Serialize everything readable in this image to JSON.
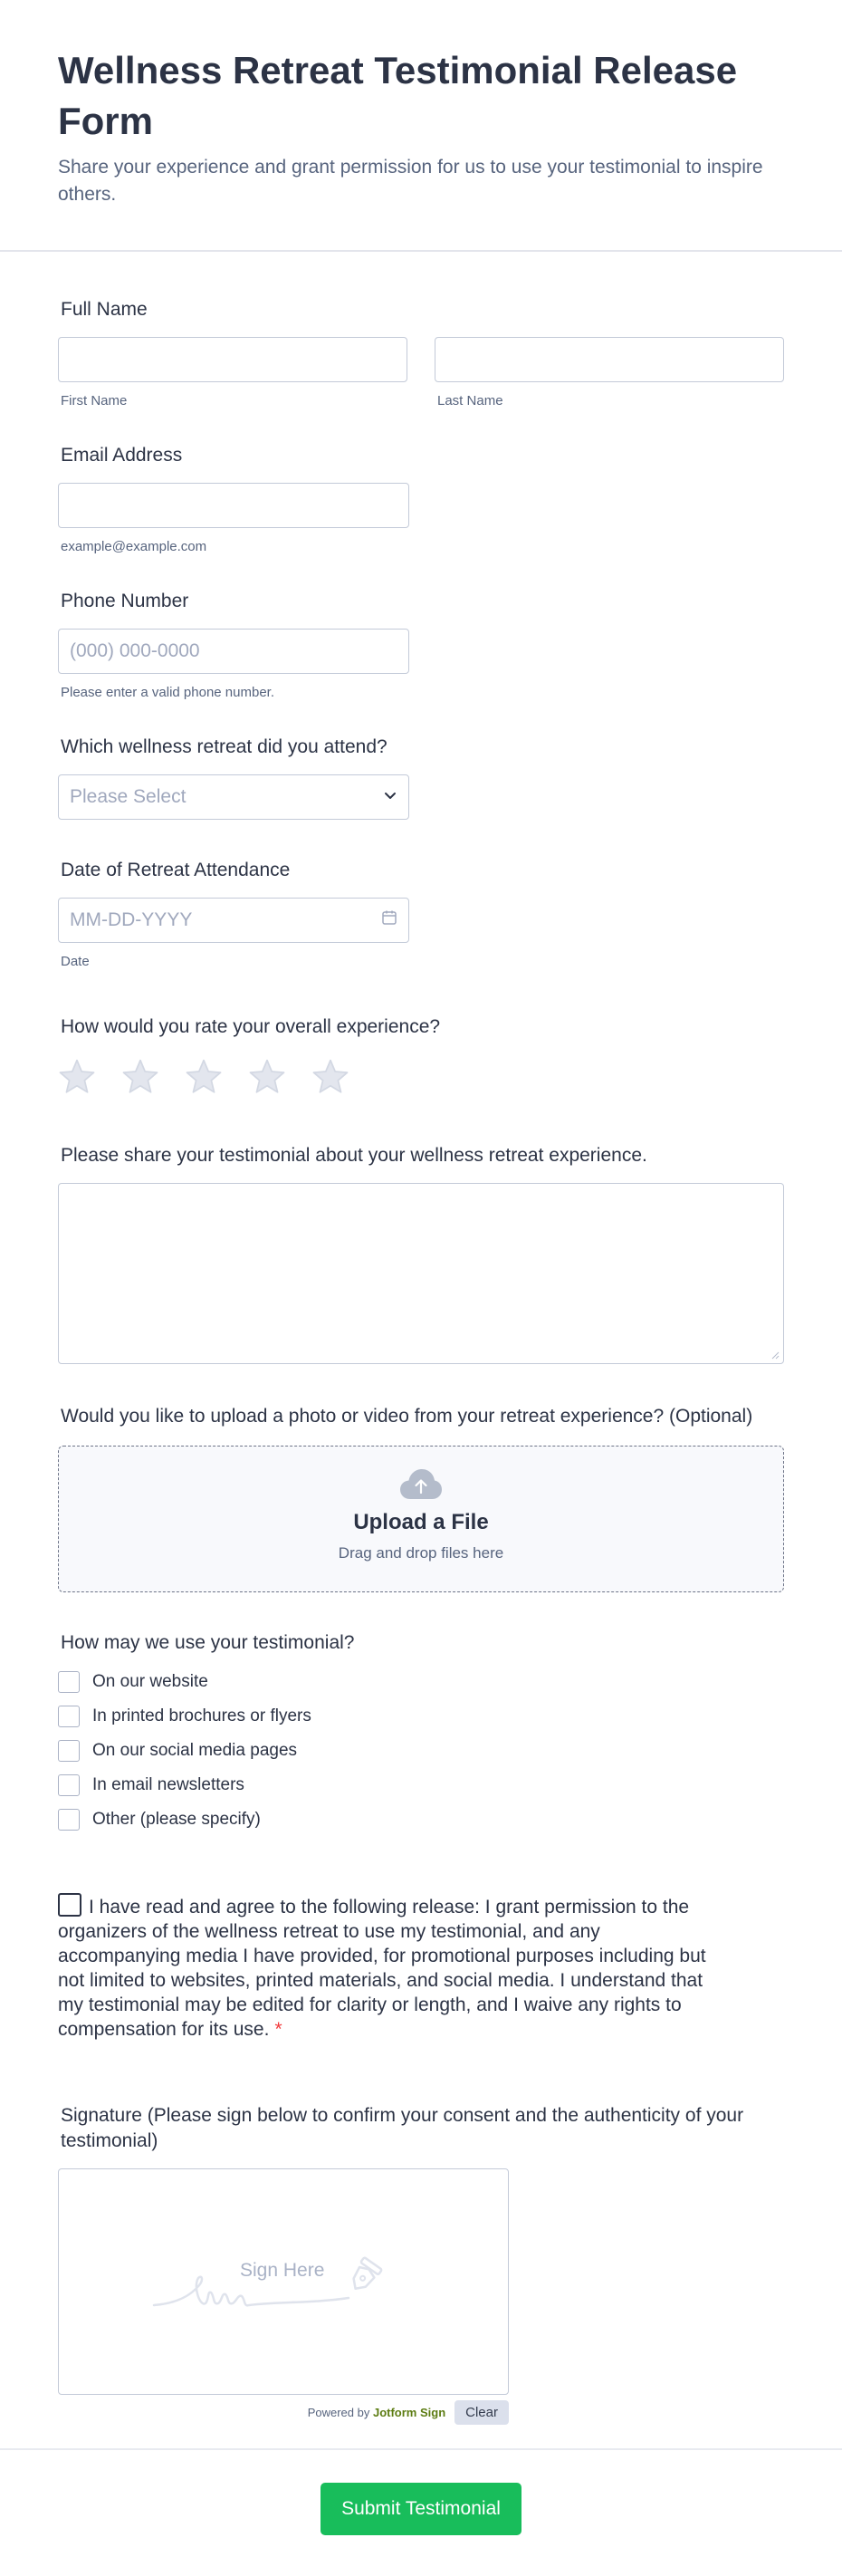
{
  "header": {
    "title": "Wellness Retreat Testimonial Release Form",
    "subtitle": "Share your experience and grant permission for us to use your testimonial to inspire others."
  },
  "full_name": {
    "label": "Full Name",
    "first_sublabel": "First Name",
    "last_sublabel": "Last Name",
    "first_value": "",
    "last_value": ""
  },
  "email": {
    "label": "Email Address",
    "value": "",
    "sublabel": "example@example.com"
  },
  "phone": {
    "label": "Phone Number",
    "placeholder": "(000) 000-0000",
    "sublabel": "Please enter a valid phone number."
  },
  "retreat": {
    "label": "Which wellness retreat did you attend?",
    "selected": "Please Select"
  },
  "date": {
    "label": "Date of Retreat Attendance",
    "placeholder": "MM-DD-YYYY",
    "sublabel": "Date"
  },
  "rating": {
    "label": "How would you rate your overall experience?",
    "max": 5,
    "value": 0
  },
  "testimonial": {
    "label": "Please share your testimonial about your wellness retreat experience.",
    "value": ""
  },
  "upload": {
    "label": "Would you like to upload a photo or video from your retreat experience? (Optional)",
    "title": "Upload a File",
    "subtitle": "Drag and drop files here"
  },
  "usage": {
    "label": "How may we use your testimonial?",
    "options": [
      "On our website",
      "In printed brochures or flyers",
      "On our social media pages",
      "In email newsletters",
      "Other (please specify)"
    ]
  },
  "consent": {
    "text": "I have read and agree to the following release: I grant permission to the organizers of the wellness retreat to use my testimonial, and any accompanying media I have provided, for promotional purposes including but not limited to websites, printed materials, and social media. I understand that my testimonial may be edited for clarity or length, and I waive any rights to compensation for its use.",
    "required_mark": "*"
  },
  "signature": {
    "label": "Signature (Please sign below to confirm your consent and the authenticity of your testimonial)",
    "placeholder": "Sign Here",
    "powered_prefix": "Powered by",
    "powered_brand": "Jotform Sign",
    "clear_label": "Clear"
  },
  "submit_label": "Submit Testimonial",
  "colors": {
    "accent": "#18bd5b",
    "border": "#c3cad8",
    "required": "#f23a3c",
    "star": "#e3e6ee"
  }
}
